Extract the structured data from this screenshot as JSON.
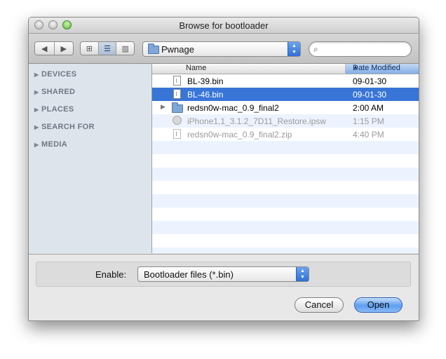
{
  "window": {
    "title": "Browse for bootloader"
  },
  "toolbar": {
    "location": "Pwnage",
    "search": {
      "value": "",
      "placeholder": ""
    }
  },
  "sidebar": {
    "sections": [
      {
        "label": "DEVICES"
      },
      {
        "label": "SHARED"
      },
      {
        "label": "PLACES"
      },
      {
        "label": "SEARCH FOR"
      },
      {
        "label": "MEDIA"
      }
    ]
  },
  "list": {
    "columns": {
      "name": "Name",
      "date": "Date Modified"
    },
    "rows": [
      {
        "name": "BL-39.bin",
        "date": "09-01-30",
        "icon": "document-icon"
      },
      {
        "name": "BL-46.bin",
        "date": "09-01-30",
        "icon": "document-icon",
        "selected": true
      },
      {
        "name": "redsn0w-mac_0.9_final2",
        "date": "2:00 AM",
        "icon": "folder-icon"
      },
      {
        "name": "iPhone1,1_3.1.2_7D11_Restore.ipsw",
        "date": "1:15 PM",
        "icon": "disk-image-icon",
        "disabled": true
      },
      {
        "name": "redsn0w-mac_0.9_final2.zip",
        "date": "4:40 PM",
        "icon": "document-icon",
        "disabled": true
      }
    ]
  },
  "filter": {
    "label": "Enable:",
    "value": "Bootloader files (*.bin)"
  },
  "buttons": {
    "cancel": "Cancel",
    "open": "Open"
  },
  "colors": {
    "selection": "#3875d7",
    "default_button": "#5e9ef0",
    "sidebar": "#dde4ec"
  }
}
